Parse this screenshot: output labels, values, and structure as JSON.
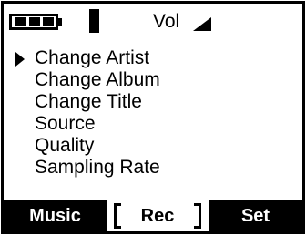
{
  "status_bar": {
    "battery_icon": "battery-icon",
    "battery_level": 0.66,
    "signal_icon": "signal-bar-icon",
    "volume_label": "Vol",
    "volume_icon": "volume-ramp-icon"
  },
  "menu": {
    "selected_index": 0,
    "items": [
      {
        "label": "Change Artist"
      },
      {
        "label": "Change Album"
      },
      {
        "label": "Change Title"
      },
      {
        "label": "Source"
      },
      {
        "label": "Quality"
      },
      {
        "label": "Sampling Rate"
      }
    ]
  },
  "softkeys": {
    "left": "Music",
    "middle": "Rec",
    "right": "Set",
    "active": "middle"
  },
  "colors": {
    "foreground": "#000000",
    "background": "#ffffff"
  }
}
